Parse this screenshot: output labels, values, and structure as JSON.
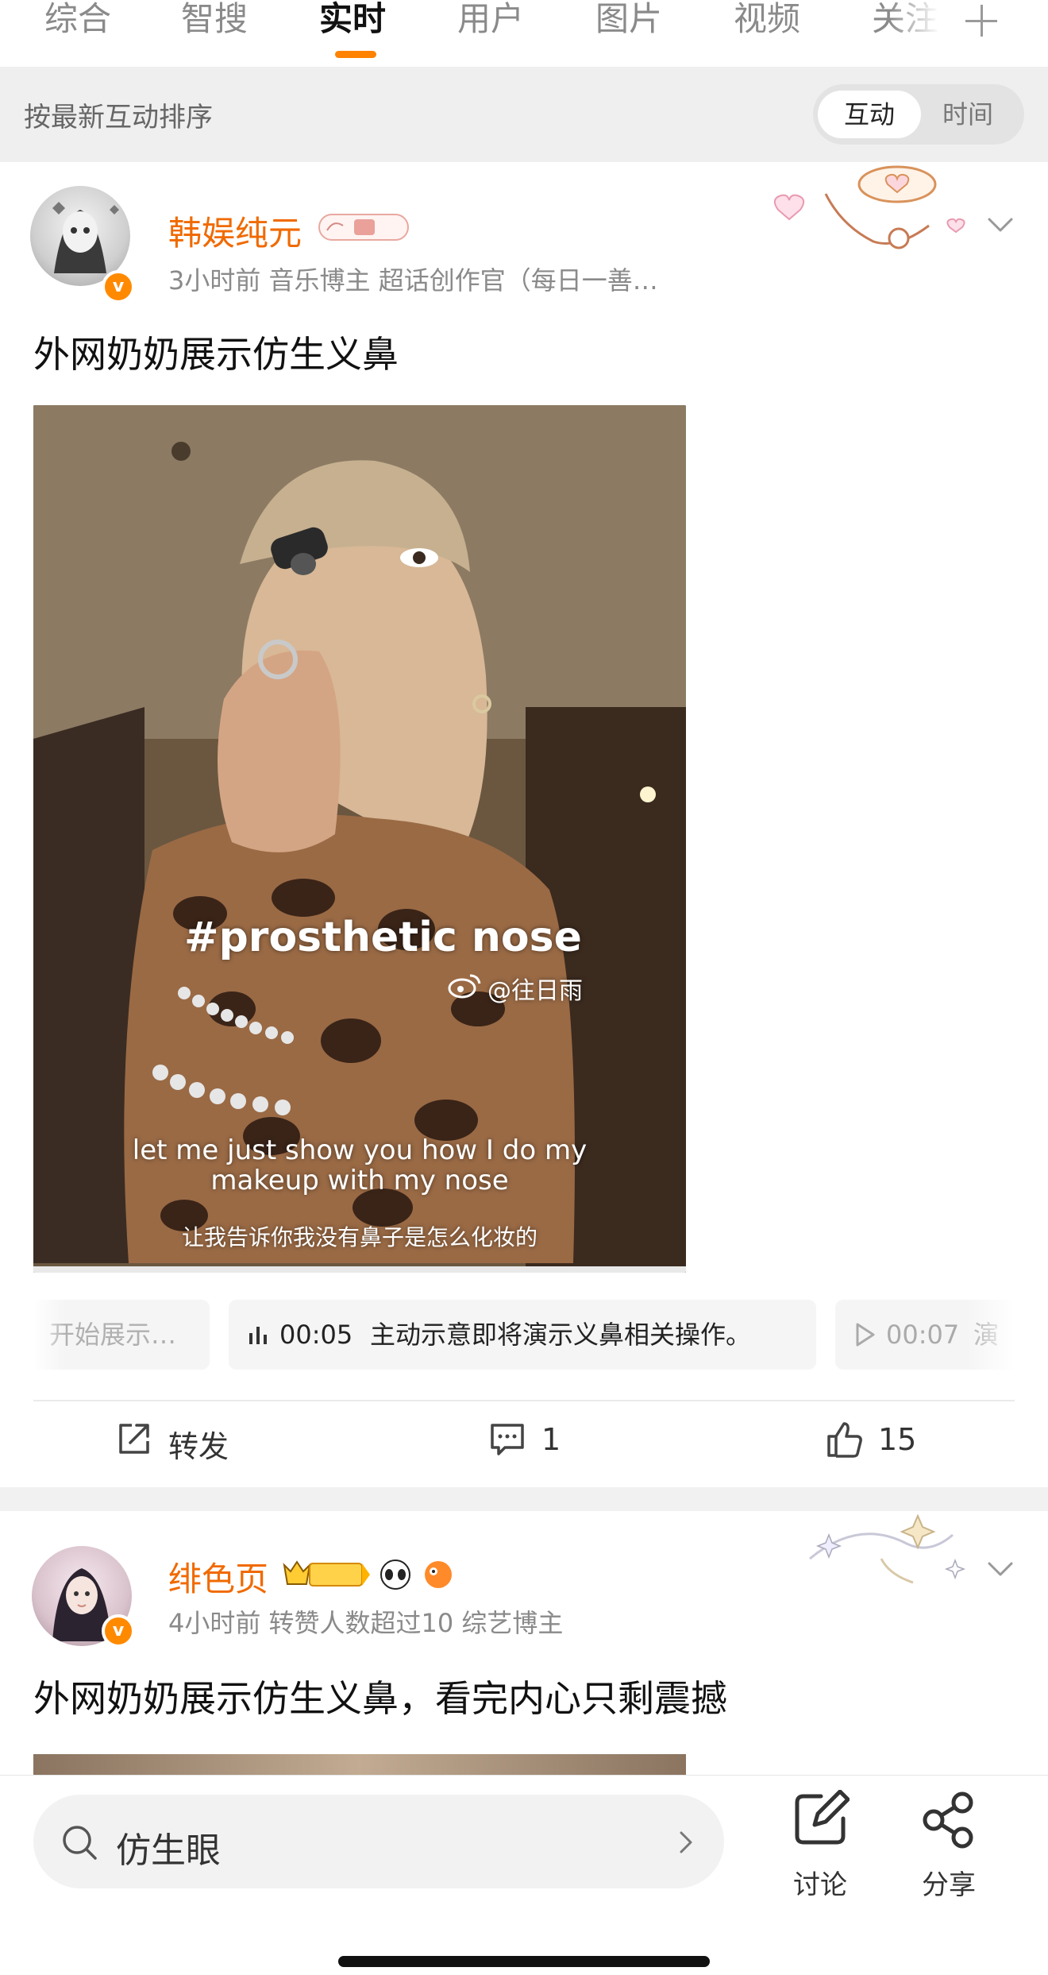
{
  "tabs": [
    {
      "label": "综合"
    },
    {
      "label": "智搜"
    },
    {
      "label": "实时"
    },
    {
      "label": "用户"
    },
    {
      "label": "图片"
    },
    {
      "label": "视频"
    },
    {
      "label": "关注"
    }
  ],
  "sortbar": {
    "label": "按最新互动排序",
    "toggle_on": "互动",
    "toggle_off": "时间"
  },
  "post1": {
    "username": "韩娱纯元",
    "meta": "3小时前  音乐博主 超话创作官（每日一善…",
    "title": "外网奶奶展示仿生义鼻",
    "video": {
      "hashtag": "#prosthetic nose",
      "watermark": "@往日雨",
      "subtitle_en_1": "let me just show you how I do my",
      "subtitle_en_2": "makeup with my nose",
      "subtitle_zh": "让我告诉你我没有鼻子是怎么化妆的"
    },
    "chapters": [
      {
        "text": "开始展示…"
      },
      {
        "time": "00:05",
        "text": "主动示意即将演示义鼻相关操作。"
      },
      {
        "time": "00:07",
        "text": "演"
      }
    ],
    "actions": {
      "repost": "转发",
      "comments": "1",
      "likes": "15"
    }
  },
  "post2": {
    "username": "绯色页",
    "meta": "4小时前 转赞人数超过10  综艺博主",
    "title": "外网奶奶展示仿生义鼻，看完内心只剩震撼"
  },
  "bottombar": {
    "search_value": "仿生眼",
    "discuss": "讨论",
    "share": "分享"
  },
  "colors": {
    "accent": "#ff8200",
    "username": "#f06a00"
  }
}
